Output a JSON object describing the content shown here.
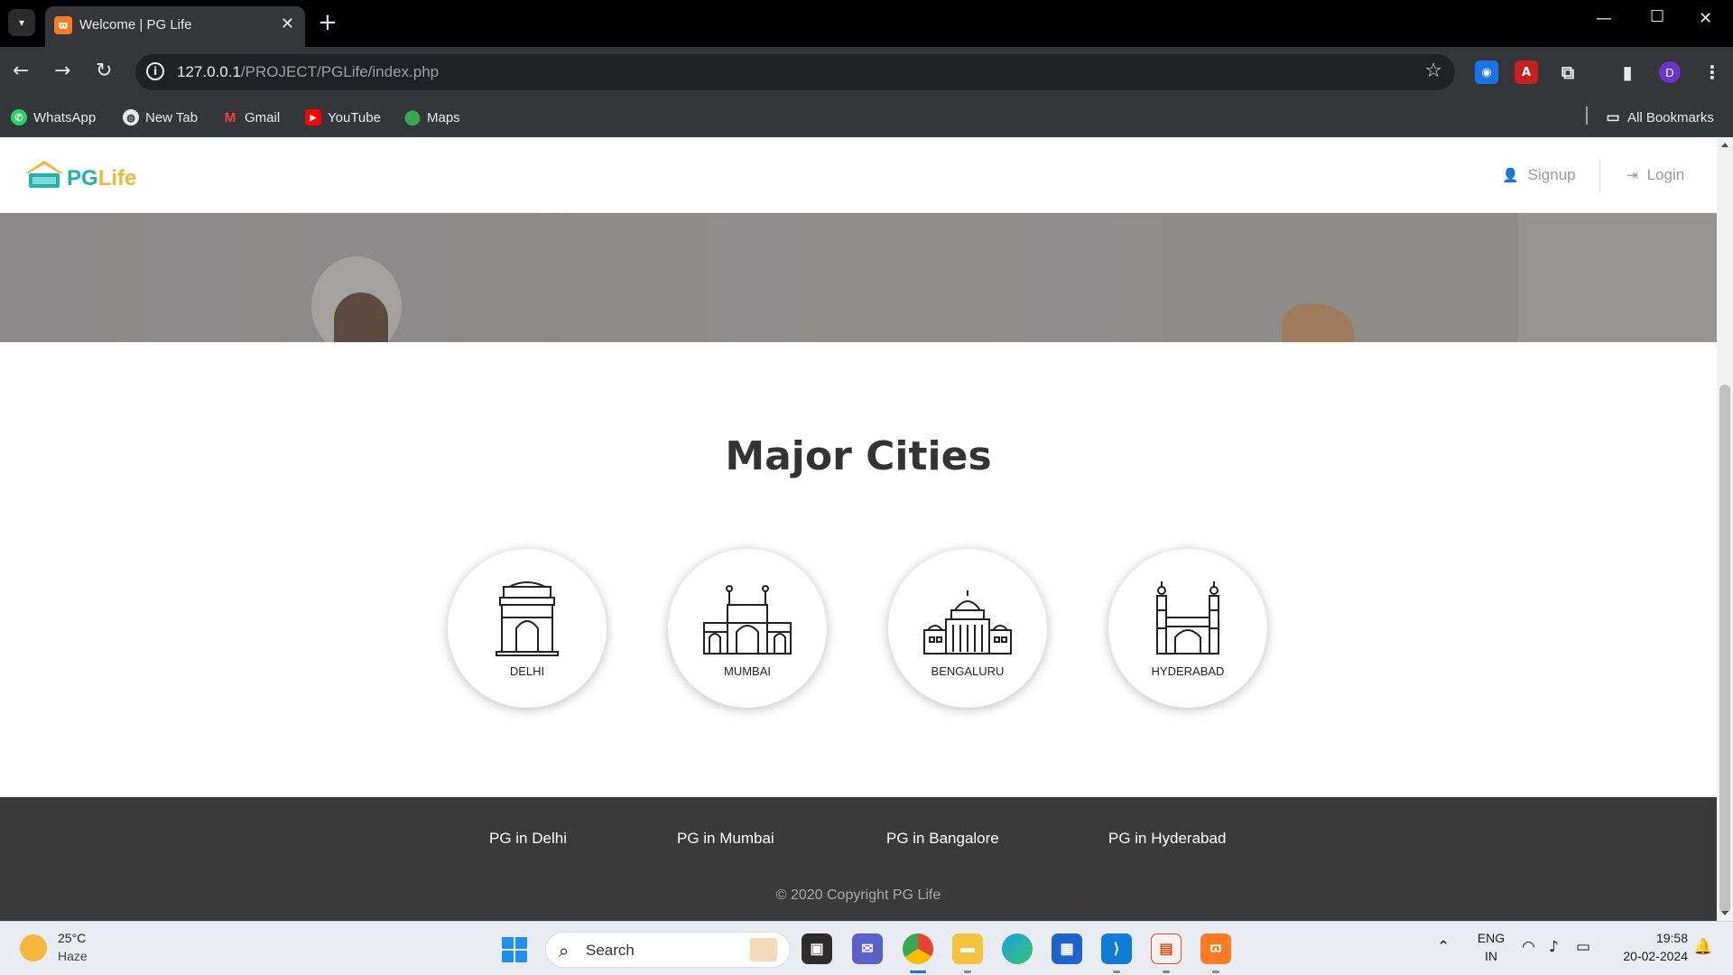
{
  "browser": {
    "tab_title": "Welcome | PG Life",
    "url_host": "127.0.0.1",
    "url_path": "/PROJECT/PGLife/index.php",
    "profile_initial": "D",
    "bookmarks": [
      {
        "label": "WhatsApp",
        "icon": "whatsapp-icon"
      },
      {
        "label": "New Tab",
        "icon": "globe-icon"
      },
      {
        "label": "Gmail",
        "icon": "gmail-icon"
      },
      {
        "label": "YouTube",
        "icon": "youtube-icon"
      },
      {
        "label": "Maps",
        "icon": "maps-icon"
      }
    ],
    "all_bookmarks": "All Bookmarks"
  },
  "site": {
    "logo_pg": "PG",
    "logo_life": "Life",
    "nav": {
      "signup": "Signup",
      "login": "Login"
    },
    "section_title": "Major Cities",
    "cities": [
      {
        "name": "DELHI",
        "icon": "india-gate-icon"
      },
      {
        "name": "MUMBAI",
        "icon": "gateway-of-india-icon"
      },
      {
        "name": "BENGALURU",
        "icon": "vidhana-soudha-icon"
      },
      {
        "name": "HYDERABAD",
        "icon": "charminar-icon"
      }
    ],
    "footer_links": [
      "PG in Delhi",
      "PG in Mumbai",
      "PG in Bangalore",
      "PG in Hyderabad"
    ],
    "copyright": "© 2020 Copyright PG Life"
  },
  "taskbar": {
    "weather_temp": "25°C",
    "weather_cond": "Haze",
    "search_placeholder": "Search",
    "lang_line1": "ENG",
    "lang_line2": "IN",
    "time": "19:58",
    "date": "20-02-2024"
  },
  "colors": {
    "logo_teal": "#1fb5ad",
    "logo_yellow": "#f7b733",
    "footer_bg": "#3a3a3a",
    "header_text": "#999999"
  }
}
